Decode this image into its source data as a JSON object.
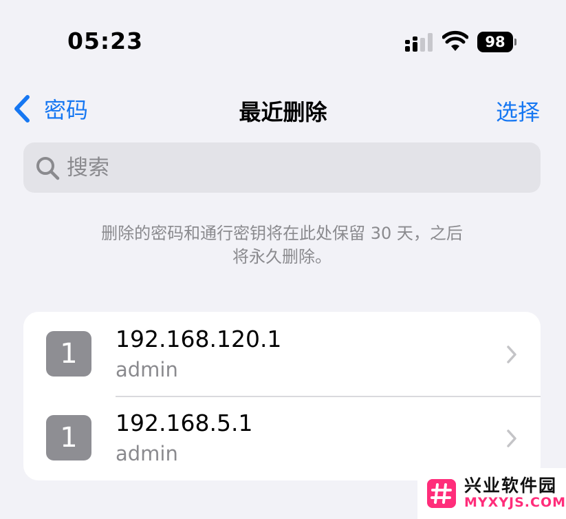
{
  "status_bar": {
    "time": "05:23",
    "battery": "98",
    "icons": [
      "signal-icon",
      "wifi-icon",
      "battery-icon"
    ]
  },
  "nav": {
    "back_label": "密码",
    "title": "最近删除",
    "action_label": "选择",
    "accent_color": "#1677f2"
  },
  "search": {
    "placeholder": "搜索",
    "value": ""
  },
  "info": {
    "line1": "删除的密码和通行密钥将在此处保留 30 天，之后",
    "line2": "将永久删除。"
  },
  "items": [
    {
      "icon_letter": "1",
      "title": "192.168.120.1",
      "subtitle": "admin"
    },
    {
      "icon_letter": "1",
      "title": "192.168.5.1",
      "subtitle": "admin"
    }
  ],
  "watermark": {
    "name_cn": "兴业软件园",
    "site": "MYXYJS.COM",
    "color": "#ff2d7a"
  }
}
